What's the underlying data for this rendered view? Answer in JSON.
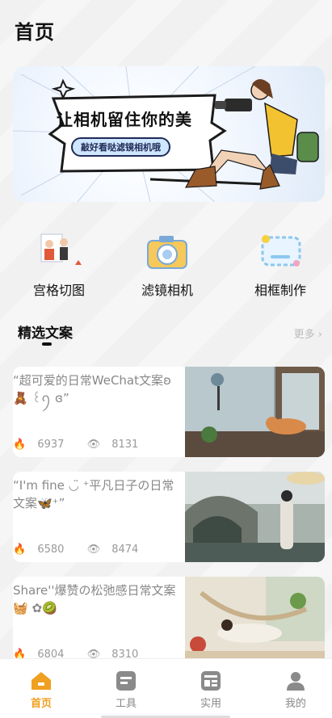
{
  "header": {
    "title": "首页"
  },
  "banner": {
    "headline": "让相机留住你的美",
    "subtitle": "敲好看哒滤镜相机哦"
  },
  "features": [
    {
      "label": "宫格切图",
      "icon": "grid-cut-photo-icon"
    },
    {
      "label": "滤镜相机",
      "icon": "filter-camera-icon"
    },
    {
      "label": "相框制作",
      "icon": "photo-frame-icon"
    }
  ],
  "section": {
    "title": "精选文案",
    "more": "更多 ›"
  },
  "cards": [
    {
      "text": "“超可爱的日常WeChat文案ʚ 🧸 ꒰ꪆ ɞ”",
      "likes": "6937",
      "views": "8131"
    },
    {
      "text": "“I'm fine ◡̈ ⁺平凡日子の日常文案🦋⁺”",
      "likes": "6580",
      "views": "8474"
    },
    {
      "text": "Share''爆赞の松弛感日常文案🧺 ✿🥝",
      "likes": "6804",
      "views": "8310"
    }
  ],
  "tabbar": {
    "items": [
      {
        "label": "首页",
        "active": true
      },
      {
        "label": "工具",
        "active": false
      },
      {
        "label": "实用",
        "active": false
      },
      {
        "label": "我的",
        "active": false
      }
    ]
  },
  "colors": {
    "accent": "#f0a020",
    "banner_badge": "#cfe6ff",
    "text_muted": "#888888"
  }
}
